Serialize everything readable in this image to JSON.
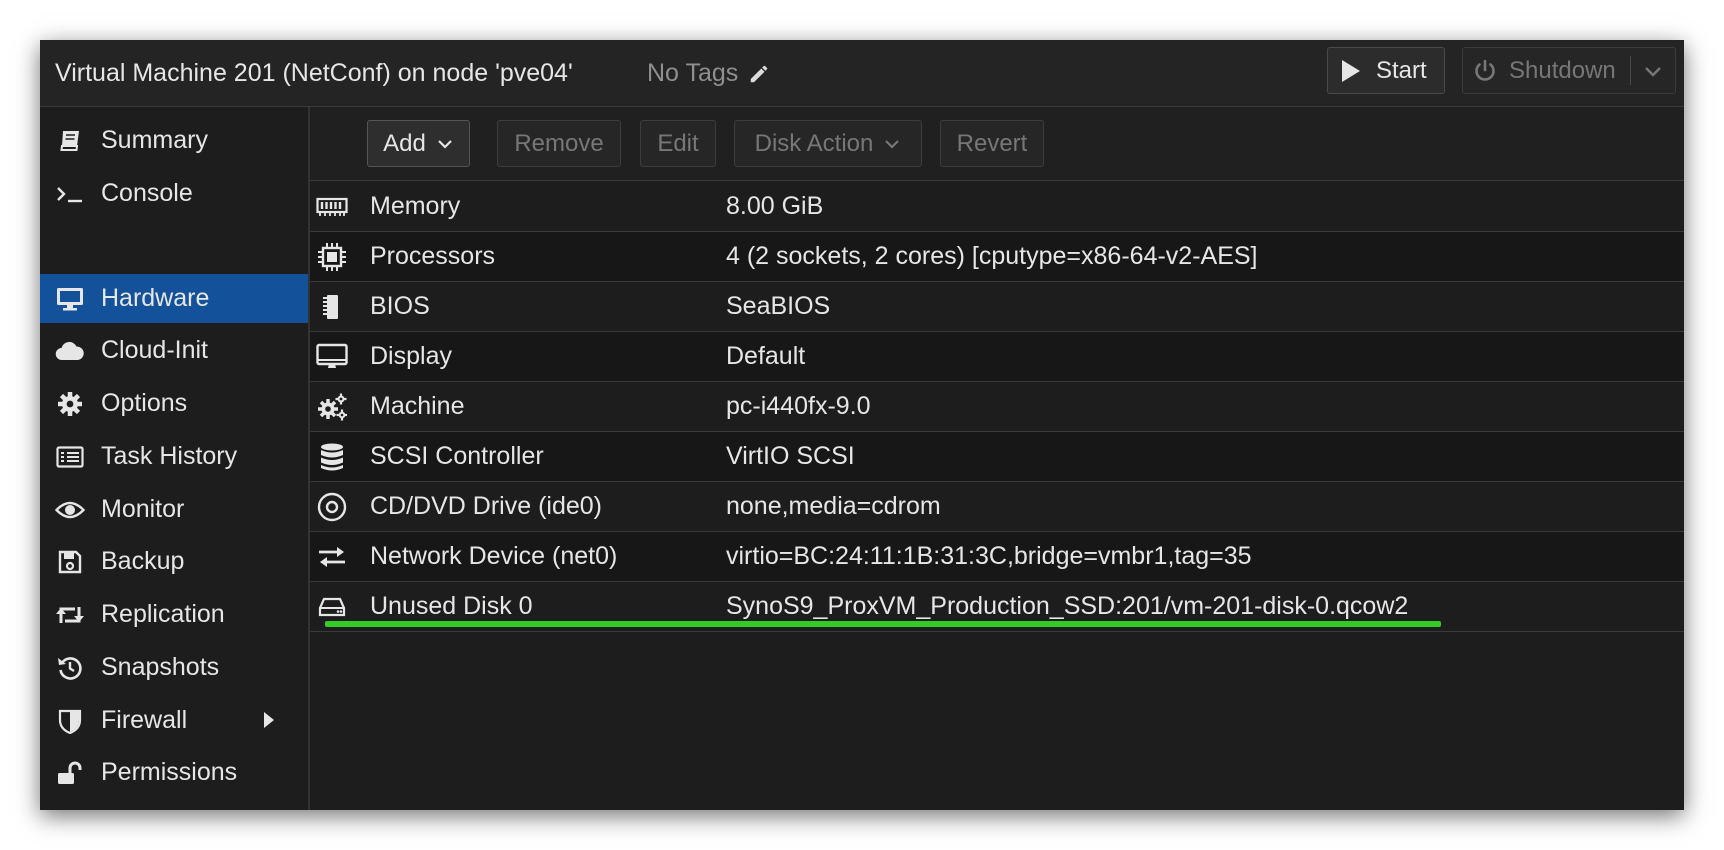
{
  "header": {
    "title": "Virtual Machine 201 (NetConf) on node 'pve04'",
    "tags_label": "No Tags",
    "start_label": "Start",
    "shutdown_label": "Shutdown"
  },
  "sidebar": {
    "items": [
      {
        "label": "Summary",
        "icon": "book-icon"
      },
      {
        "label": "Console",
        "icon": "terminal-icon"
      },
      {
        "label": "Hardware",
        "icon": "monitor-icon",
        "active": true
      },
      {
        "label": "Cloud-Init",
        "icon": "cloud-icon"
      },
      {
        "label": "Options",
        "icon": "gear-icon"
      },
      {
        "label": "Task History",
        "icon": "list-icon"
      },
      {
        "label": "Monitor",
        "icon": "eye-icon"
      },
      {
        "label": "Backup",
        "icon": "floppy-icon"
      },
      {
        "label": "Replication",
        "icon": "retweet-icon"
      },
      {
        "label": "Snapshots",
        "icon": "history-icon"
      },
      {
        "label": "Firewall",
        "icon": "shield-icon"
      },
      {
        "label": "Permissions",
        "icon": "unlock-icon"
      }
    ]
  },
  "toolbar": {
    "add_label": "Add",
    "remove_label": "Remove",
    "edit_label": "Edit",
    "disk_action_label": "Disk Action",
    "revert_label": "Revert"
  },
  "hardware": {
    "rows": [
      {
        "name": "Memory",
        "value": "8.00 GiB",
        "icon": "memory-icon"
      },
      {
        "name": "Processors",
        "value": "4 (2 sockets, 2 cores) [cputype=x86-64-v2-AES]",
        "icon": "cpu-icon"
      },
      {
        "name": "BIOS",
        "value": "SeaBIOS",
        "icon": "microchip-icon"
      },
      {
        "name": "Display",
        "value": "Default",
        "icon": "desktop-icon"
      },
      {
        "name": "Machine",
        "value": "pc-i440fx-9.0",
        "icon": "cogs-icon"
      },
      {
        "name": "SCSI Controller",
        "value": "VirtIO SCSI",
        "icon": "database-icon"
      },
      {
        "name": "CD/DVD Drive (ide0)",
        "value": "none,media=cdrom",
        "icon": "disc-icon"
      },
      {
        "name": "Network Device (net0)",
        "value": "virtio=BC:24:11:1B:31:3C,bridge=vmbr1,tag=35",
        "icon": "exchange-icon"
      },
      {
        "name": "Unused Disk 0",
        "value": "SynoS9_ProxVM_Production_SSD:201/vm-201-disk-0.qcow2",
        "icon": "hdd-icon"
      }
    ]
  },
  "colors": {
    "accent": "#13519a",
    "highlight": "#33cc22"
  }
}
